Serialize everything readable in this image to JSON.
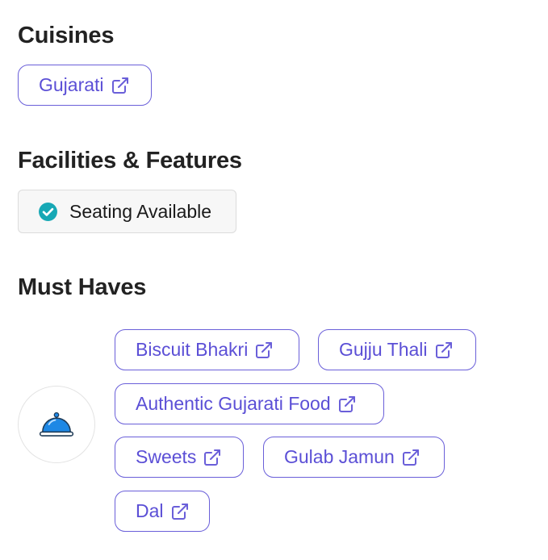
{
  "cuisines": {
    "title": "Cuisines",
    "tags": [
      {
        "label": "Gujarati"
      }
    ]
  },
  "facilities": {
    "title": "Facilities & Features",
    "items": [
      {
        "label": "Seating Available",
        "icon": "check-circle-icon",
        "icon_color": "#17a8b5"
      }
    ]
  },
  "must_haves": {
    "title": "Must Haves",
    "icon": "food-cloche-icon",
    "tags": [
      {
        "label": "Biscuit Bhakri"
      },
      {
        "label": "Gujju Thali"
      },
      {
        "label": "Authentic Gujarati Food"
      },
      {
        "label": "Sweets"
      },
      {
        "label": "Gulab Jamun"
      },
      {
        "label": "Dal"
      }
    ]
  },
  "colors": {
    "accent": "#5b4fd6",
    "tag_border": "#6a5fd9",
    "check": "#17a8b5",
    "heading": "#222222"
  }
}
